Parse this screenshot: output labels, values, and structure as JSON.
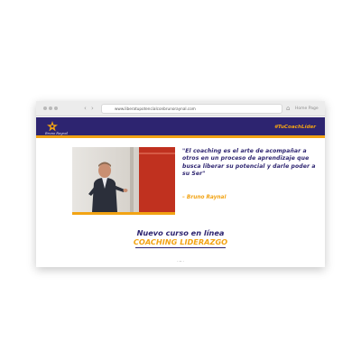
{
  "browser": {
    "url": "www.liberatupotencialconbrunoraynal.com",
    "home_label": "Home Page"
  },
  "site": {
    "logo_text": "Bruno Raynal",
    "hashtag": "#TuCoachLíder"
  },
  "hero": {
    "quote": "\"El coaching es el arte de acompañar a otros en un proceso de aprendizaje que busca liberar su potencial y darle poder a su Ser\"",
    "author": "– Bruno Raynal"
  },
  "course": {
    "title": "Nuevo curso en línea",
    "subtitle": "COACHING LIDERAZGO"
  },
  "colors": {
    "navy": "#2d2470",
    "gold": "#f2a313",
    "red": "#c0311f"
  },
  "icons": {
    "back": "back-arrow-icon",
    "forward": "forward-arrow-icon",
    "home": "home-icon",
    "logo": "logo-star-icon"
  }
}
